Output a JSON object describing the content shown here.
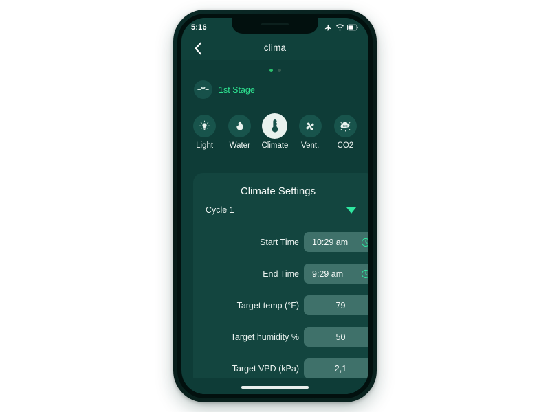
{
  "status_bar": {
    "time": "5:16",
    "icons": [
      "airplane-icon",
      "wifi-icon",
      "battery-icon"
    ]
  },
  "nav": {
    "back_icon": "chevron-left-icon",
    "title": "clima"
  },
  "pager": {
    "dots": 2,
    "active_index": 0,
    "active_color": "#2bbf6c",
    "inactive_color": "#35594f"
  },
  "stage": {
    "icon": "sprout-icon",
    "label": "1st Stage",
    "color": "#2de08f"
  },
  "modes": [
    {
      "label": "Light",
      "icon": "lightbulb-icon",
      "selected": false
    },
    {
      "label": "Water",
      "icon": "water-drop-icon",
      "selected": false
    },
    {
      "label": "Climate",
      "icon": "thermometer-icon",
      "selected": true
    },
    {
      "label": "Vent.",
      "icon": "fan-icon",
      "selected": false
    },
    {
      "label": "CO2",
      "icon": "co2-molecule-icon",
      "selected": false
    }
  ],
  "card": {
    "title": "Climate Settings",
    "cycle": {
      "label": "Cycle 1",
      "caret_icon": "caret-down-icon",
      "caret_color": "#2ee8a0"
    },
    "fields": [
      {
        "label": "Start Time",
        "value": "10:29 am",
        "icon": "clock-icon",
        "align": "left"
      },
      {
        "label": "End Time",
        "value": "9:29 am",
        "icon": "clock-icon",
        "align": "left"
      },
      {
        "label": "Target temp (°F)",
        "value": "79",
        "icon": null,
        "align": "center"
      },
      {
        "label": "Target humidity %",
        "value": "50",
        "icon": null,
        "align": "center"
      },
      {
        "label": "Target VPD (kPa)",
        "value": "2,1",
        "icon": null,
        "align": "center"
      }
    ]
  },
  "theme": {
    "screen_bg": "#0e3c37",
    "header_bg": "#10413b",
    "card_bg": "#13453f",
    "field_bg": "#3f716a",
    "accent_green": "#2ee8a0",
    "text_primary": "#f3f8f6"
  }
}
